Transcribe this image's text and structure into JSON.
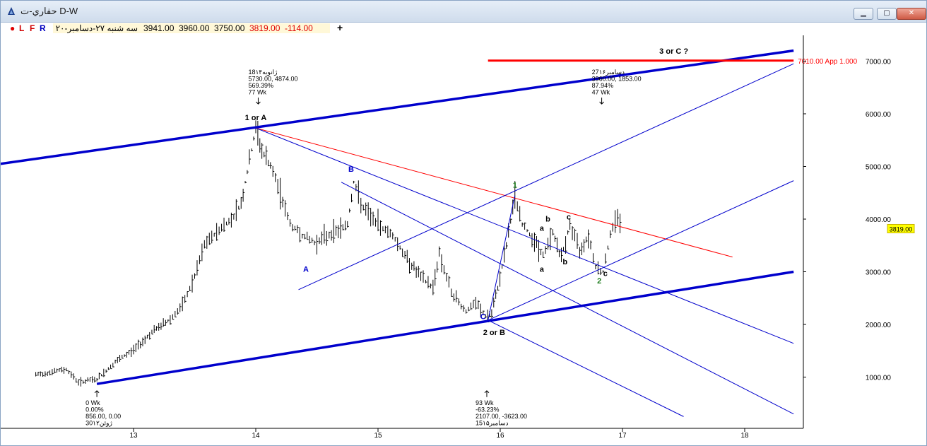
{
  "window": {
    "title": "حفاري-ت D-W",
    "buttons": [
      "minimize",
      "maximize",
      "close"
    ]
  },
  "toolbar": {
    "flags": [
      "L",
      "F",
      "R"
    ],
    "date": "سه شنبه ۲۷-دسامبر-۲۰",
    "open": "3941.00",
    "high": "3960.00",
    "low": "3750.00",
    "close": "3819.00",
    "change": "-114.00",
    "add": "+"
  },
  "chart_data": {
    "type": "bar",
    "title": "",
    "xlabel": "",
    "ylabel": "",
    "x_ticks": [
      "13",
      "14",
      "15",
      "16",
      "17",
      "18"
    ],
    "y_ticks": [
      "1000.00",
      "2000.00",
      "3000.00",
      "4000.00",
      "5000.00",
      "6000.00",
      "7000.00"
    ],
    "ylim": [
      250,
      7500
    ],
    "last_price_tag": "3819.00",
    "horizontal_level": {
      "value": 7010,
      "label": "7010.00 App 1.000",
      "color": "#ff0000"
    },
    "price_path": [
      [
        12.2,
        1040
      ],
      [
        12.45,
        1150
      ],
      [
        12.55,
        900
      ],
      [
        12.7,
        960
      ],
      [
        12.85,
        1280
      ],
      [
        13.0,
        1520
      ],
      [
        13.15,
        1850
      ],
      [
        13.3,
        2100
      ],
      [
        13.4,
        2350
      ],
      [
        13.5,
        2900
      ],
      [
        13.58,
        3500
      ],
      [
        13.7,
        3800
      ],
      [
        13.8,
        4000
      ],
      [
        13.88,
        4300
      ],
      [
        13.93,
        4900
      ],
      [
        14.0,
        5730
      ],
      [
        14.05,
        5300
      ],
      [
        14.12,
        5000
      ],
      [
        14.2,
        4500
      ],
      [
        14.28,
        3900
      ],
      [
        14.38,
        3700
      ],
      [
        14.48,
        3550
      ],
      [
        14.6,
        3700
      ],
      [
        14.75,
        3900
      ],
      [
        14.8,
        4700
      ],
      [
        14.88,
        4200
      ],
      [
        15.0,
        3900
      ],
      [
        15.12,
        3700
      ],
      [
        15.22,
        3300
      ],
      [
        15.35,
        2900
      ],
      [
        15.45,
        2700
      ],
      [
        15.5,
        3350
      ],
      [
        15.6,
        2600
      ],
      [
        15.72,
        2250
      ],
      [
        15.8,
        2400
      ],
      [
        15.88,
        2150
      ],
      [
        15.93,
        2200
      ],
      [
        15.98,
        2700
      ],
      [
        16.05,
        3500
      ],
      [
        16.12,
        4450
      ],
      [
        16.18,
        3900
      ],
      [
        16.28,
        3600
      ],
      [
        16.35,
        3300
      ],
      [
        16.43,
        3750
      ],
      [
        16.5,
        3250
      ],
      [
        16.57,
        3900
      ],
      [
        16.65,
        3400
      ],
      [
        16.72,
        3700
      ],
      [
        16.78,
        3100
      ],
      [
        16.84,
        3000
      ],
      [
        16.9,
        3700
      ],
      [
        16.96,
        4100
      ],
      [
        17.0,
        3819
      ]
    ],
    "lines": [
      {
        "color": "#0000cc",
        "width": "thick",
        "points": [
          [
            11.55,
            4930
          ],
          [
            18.4,
            7200
          ]
        ]
      },
      {
        "color": "#0000cc",
        "width": "thick",
        "points": [
          [
            12.7,
            870
          ],
          [
            18.4,
            3000
          ]
        ]
      },
      {
        "color": "#ff0000",
        "width": "thin",
        "points": [
          [
            14.0,
            5730
          ],
          [
            17.9,
            3280
          ]
        ]
      },
      {
        "color": "#0000cc",
        "width": "thin",
        "points": [
          [
            14.0,
            5730
          ],
          [
            18.4,
            1640
          ]
        ]
      },
      {
        "color": "#0000cc",
        "width": "thin",
        "points": [
          [
            14.35,
            2660
          ],
          [
            18.4,
            6950
          ]
        ]
      },
      {
        "color": "#0000cc",
        "width": "thin",
        "points": [
          [
            15.9,
            2080
          ],
          [
            18.4,
            4730
          ]
        ]
      },
      {
        "color": "#0000cc",
        "width": "thin",
        "points": [
          [
            14.7,
            4700
          ],
          [
            18.4,
            300
          ]
        ]
      },
      {
        "color": "#0000cc",
        "width": "thin",
        "points": [
          [
            15.9,
            2080
          ],
          [
            17.5,
            250
          ]
        ]
      },
      {
        "color": "#0000cc",
        "width": "thin",
        "points": [
          [
            15.9,
            2080
          ],
          [
            16.12,
            4450
          ]
        ]
      }
    ],
    "wave_labels": [
      {
        "text": "1 or A",
        "x": 14.0,
        "y": 5880,
        "color": "#000000"
      },
      {
        "text": "B",
        "x": 14.78,
        "y": 4900,
        "color": "#0000cc"
      },
      {
        "text": "A",
        "x": 14.41,
        "y": 3000,
        "color": "#0000cc"
      },
      {
        "text": "C",
        "x": 15.86,
        "y": 2100,
        "color": "#0000cc"
      },
      {
        "text": "2 or B",
        "x": 15.95,
        "y": 1800,
        "color": "#000000"
      },
      {
        "text": "1",
        "x": 16.12,
        "y": 4600,
        "color": "#1a7a1a"
      },
      {
        "text": "2",
        "x": 16.81,
        "y": 2780,
        "color": "#1a7a1a"
      },
      {
        "text": "3 or C ?",
        "x": 17.42,
        "y": 7140,
        "color": "#000000"
      },
      {
        "text": "a",
        "x": 16.34,
        "y": 3780,
        "color": "#000000"
      },
      {
        "text": "a",
        "x": 16.34,
        "y": 3000,
        "color": "#000000"
      },
      {
        "text": "b",
        "x": 16.39,
        "y": 3950,
        "color": "#000000"
      },
      {
        "text": "b",
        "x": 16.53,
        "y": 3140,
        "color": "#000000"
      },
      {
        "text": "c",
        "x": 16.56,
        "y": 3990,
        "color": "#000000"
      },
      {
        "text": "c",
        "x": 16.86,
        "y": 2920,
        "color": "#000000"
      }
    ],
    "info_boxes": [
      {
        "x": 14.02,
        "y": 6750,
        "lines": [
          "18ژانویه۱۴",
          "5730.00, 4874.00",
          "569.39%",
          "77 Wk"
        ],
        "arrow": "down"
      },
      {
        "x": 16.83,
        "y": 6750,
        "lines": [
          "27دسامبر۱۶",
          "3960.00, 1853.00",
          "87.94%",
          "47 Wk"
        ],
        "arrow": "down"
      },
      {
        "x": 12.7,
        "y": 580,
        "lines": [
          "0 Wk",
          "0.00%",
          "856.00, 0.00",
          "30ژوئن۱۲"
        ],
        "arrow": "up"
      },
      {
        "x": 15.89,
        "y": 580,
        "lines": [
          "93 Wk",
          "-63.23%",
          "2107.00, -3623.00",
          "15دسامبر۱۵"
        ],
        "arrow": "up"
      }
    ]
  }
}
